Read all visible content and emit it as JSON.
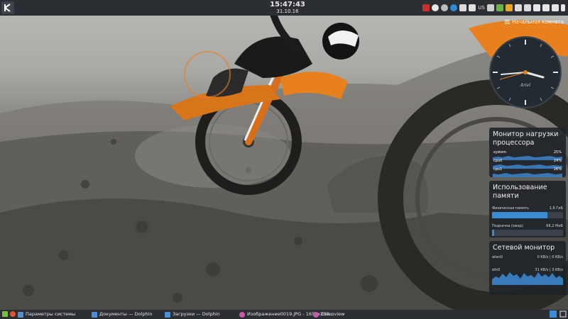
{
  "top_panel": {
    "clock_time": "15:47:43",
    "clock_date": "31.10.16",
    "keyboard_layout": "US",
    "tray_icons": [
      "kde-icon",
      "media-icon",
      "clock-icon",
      "steam-icon",
      "network-icon",
      "info-icon",
      "lock-icon",
      "sync-icon",
      "cloud-icon",
      "telegram-icon",
      "battery-icon",
      "volume-icon",
      "bluetooth-icon",
      "notifications-icon",
      "brightness-icon"
    ]
  },
  "desktop": {
    "menu_label": "Начальная комната"
  },
  "clock_widget": {
    "brand": "Ariel"
  },
  "cpu_widget": {
    "title": "Монитор нагрузки процессора",
    "rows": [
      {
        "label": "system",
        "value": "25%"
      },
      {
        "label": "cpu0",
        "value": "24%"
      },
      {
        "label": "cpu1",
        "value": "26%"
      }
    ]
  },
  "memory_widget": {
    "title": "Использование памяти",
    "physical_label": "Физическая память",
    "physical_value": "1,6 ГиБ",
    "physical_fraction": 0.78,
    "swap_label": "Подкачка (swap)",
    "swap_value": "66,2 МиБ",
    "swap_fraction": 0.03
  },
  "network_widget": {
    "title": "Сетевой монитор",
    "iface1_label": "wlan0",
    "iface1_value": "0 KB/s | 0 KB/s",
    "iface2_label": "eth0",
    "iface2_value": "31 KB/s | 3 KB/s"
  },
  "taskbar": {
    "tasks": [
      {
        "label": "Параметры системы",
        "icon": "settings-icon"
      },
      {
        "label": "Документы — Dolphin",
        "icon": "folder-icon"
      },
      {
        "label": "Загрузки — Dolphin",
        "icon": "folder-icon"
      },
      {
        "label": "Изображение0019.JPG - 1653x233...",
        "icon": "image-viewer-icon"
      },
      {
        "label": "Gwenview",
        "icon": "image-viewer-icon"
      }
    ]
  },
  "colors": {
    "panel": "#2b2f33",
    "accent": "#3d8bd4",
    "bike_orange": "#e8801e"
  }
}
